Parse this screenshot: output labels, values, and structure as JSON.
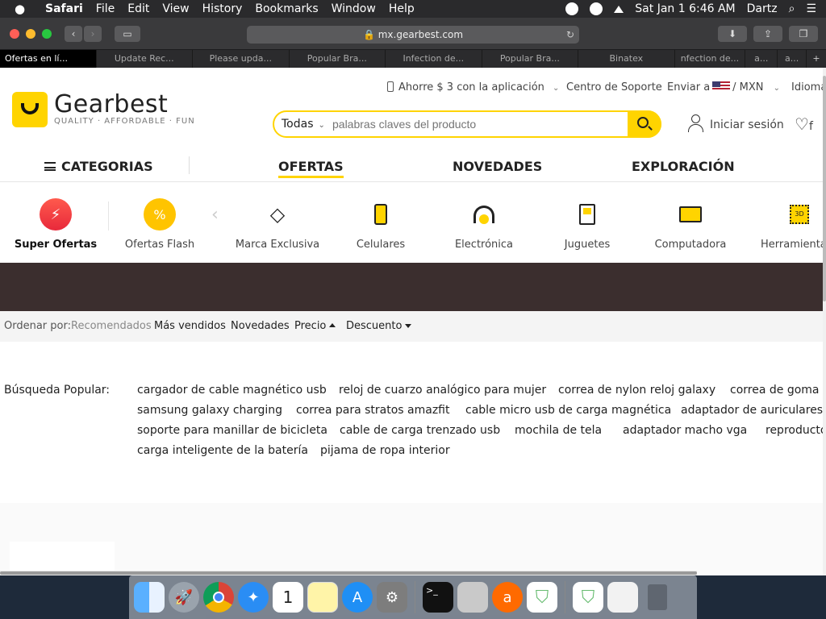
{
  "menubar": {
    "apple": "",
    "items": [
      "Safari",
      "File",
      "Edit",
      "View",
      "History",
      "Bookmarks",
      "Window",
      "Help"
    ],
    "clock": "Sat Jan 1  6:46 AM",
    "user": "Dartz"
  },
  "browser": {
    "url": "mx.gearbest.com",
    "tabs": [
      "Ofertas en lí...",
      "Update Rec...",
      "Please upda...",
      "Popular Bra...",
      "Infection de...",
      "Popular Bra...",
      "Binatex",
      "nfection de...",
      "a...",
      "a..."
    ]
  },
  "topbar": {
    "app_promo": "Ahorre $ 3 con la aplicación",
    "support": "Centro de Soporte",
    "ship_to": "Enviar a",
    "currency": "/ MXN",
    "language": "Idioma"
  },
  "header": {
    "brand": "Gearbest",
    "tagline": "QUALITY · AFFORDABLE · FUN",
    "search_category": "Todas",
    "search_placeholder": "palabras claves del producto",
    "login": "Iniciar sesión",
    "wishlist_partial": "f"
  },
  "nav": {
    "categories": "CATEGORIAS",
    "offers": "OFERTAS",
    "news": "NOVEDADES",
    "explore": "EXPLORACIÓN"
  },
  "categories": [
    {
      "label": "Super Ofertas",
      "icon": "lightning-icon"
    },
    {
      "label": "Ofertas Flash",
      "icon": "discount-badge-icon"
    },
    {
      "label": "Marca Exclusiva",
      "icon": "diamond-icon"
    },
    {
      "label": "Celulares",
      "icon": "phone-icon"
    },
    {
      "label": "Electrónica",
      "icon": "headphones-icon"
    },
    {
      "label": "Juguetes",
      "icon": "gameboy-icon"
    },
    {
      "label": "Computadora",
      "icon": "monitor-icon"
    },
    {
      "label": "Herramientas",
      "icon": "printer-3d-icon"
    }
  ],
  "sort": {
    "label": "Ordenar por:",
    "recommended": "Recomendados",
    "best_sellers": "Más vendidos",
    "new": "Novedades",
    "price": "Precio",
    "discount": "Descuento"
  },
  "popular": {
    "label": "Búsqueda Popular:",
    "rows": [
      [
        "cargador de cable magnético usb",
        "reloj de cuarzo analógico para mujer",
        "correa de nylon reloj galaxy",
        "correa de goma p"
      ],
      [
        "samsung galaxy charging",
        "correa para stratos amazfit",
        "cable micro usb de carga magnética",
        "adaptador de auriculares y"
      ],
      [
        "soporte para manillar de bicicleta",
        "cable de carga trenzado usb",
        "mochila de tela",
        "adaptador macho vga",
        "reproductor"
      ],
      [
        "carga inteligente de la batería",
        "pijama de ropa interior"
      ]
    ]
  },
  "colors": {
    "brand_yellow": "#ffd400",
    "banner_dark": "#3b2e2e"
  },
  "dock": [
    "finder-icon",
    "launchpad-icon",
    "chrome-icon",
    "safari-icon",
    "calendar-icon",
    "notes-icon",
    "app-store-icon",
    "system-preferences-icon",
    "terminal-icon",
    "disk-utility-icon",
    "avast-icon",
    "adguard-icon",
    "adguard-alt-icon",
    "preview-icon",
    "trash-icon"
  ],
  "calendar_day": "1"
}
